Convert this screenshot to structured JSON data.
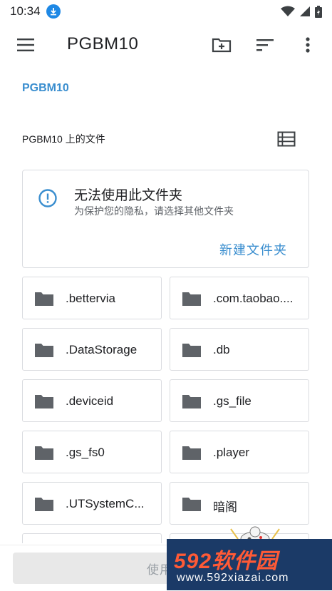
{
  "status_bar": {
    "time": "10:34"
  },
  "app_bar": {
    "title": "PGBM10"
  },
  "breadcrumb": "PGBM10",
  "section": {
    "title": "PGBM10 上的文件"
  },
  "warning": {
    "title": "无法使用此文件夹",
    "subtitle": "为保护您的隐私，请选择其他文件夹",
    "action": "新建文件夹"
  },
  "folders": [
    ".bettervia",
    ".com.taobao....",
    ".DataStorage",
    ".db",
    ".deviceid",
    ".gs_file",
    ".gs_fs0",
    ".player",
    ".UTSystemC...",
    "暗阁"
  ],
  "bottom": {
    "button_label": "使用此"
  },
  "watermark": {
    "title": "592软件园",
    "subtitle": "www.592xiazai.com"
  },
  "colors": {
    "accent": "#3a8ecf",
    "icon": "#5f6368",
    "border": "#dadce0"
  }
}
